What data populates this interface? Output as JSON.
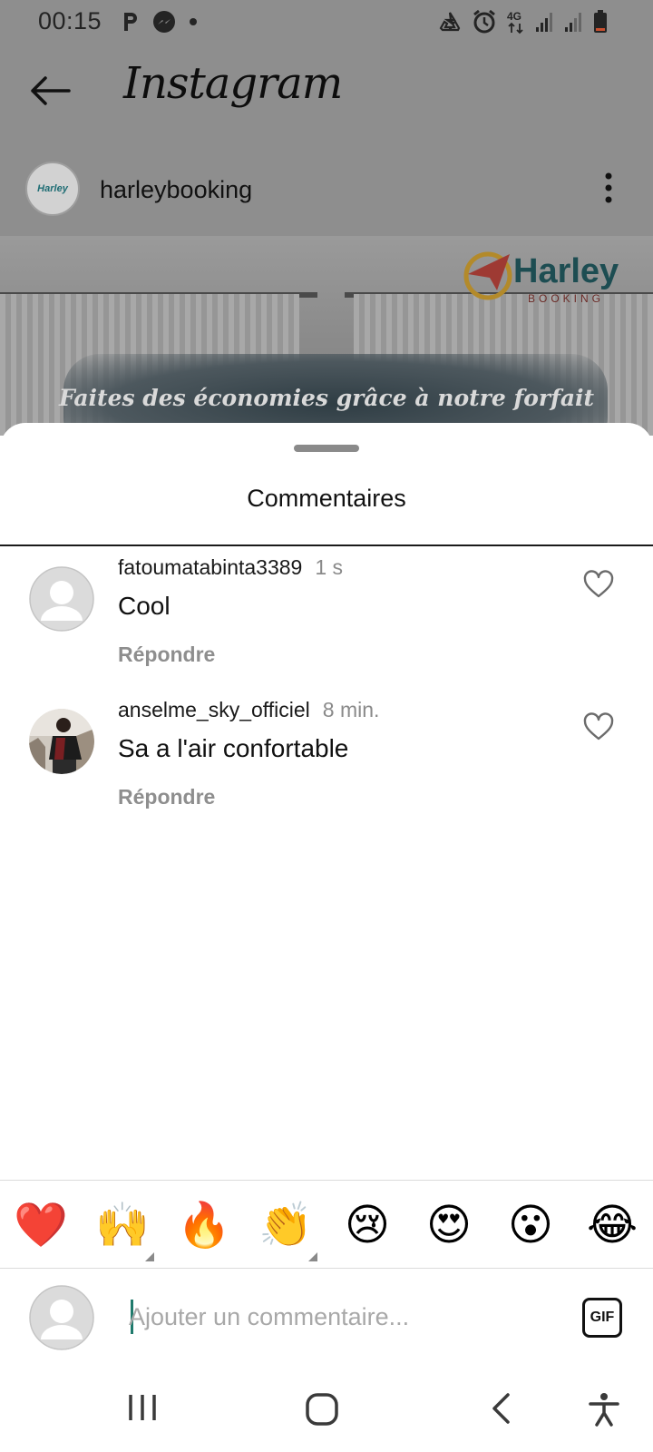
{
  "status_bar": {
    "time": "00:15",
    "icons_left": [
      "parking-icon",
      "messenger-icon",
      "notification-dot-icon"
    ],
    "icons_right": [
      "recycle-icon",
      "alarm-icon",
      "network-4g-icon",
      "signal-icon",
      "signal-icon",
      "battery-low-icon"
    ],
    "network_label": "4G"
  },
  "header": {
    "app_title": "Instagram",
    "back_icon": "back-arrow-icon"
  },
  "post": {
    "username": "harleybooking",
    "avatar_logo_text": "Harley",
    "caption_overlay": "Faites des économies grâce à notre forfait",
    "brand_name": "Harley",
    "brand_sub": "BOOKING",
    "more_icon": "more-vertical-icon"
  },
  "comments_sheet": {
    "title": "Commentaires",
    "comments": [
      {
        "username": "fatoumatabinta3389",
        "time": "1 s",
        "text": "Cool",
        "reply_label": "Répondre",
        "liked": false
      },
      {
        "username": "anselme_sky_officiel",
        "time": "8 min.",
        "text": "Sa a l'air confortable",
        "reply_label": "Répondre",
        "liked": false
      }
    ]
  },
  "quick_reactions": [
    {
      "name": "red-heart",
      "glyph": "❤️"
    },
    {
      "name": "raising-hands",
      "glyph": "🙌"
    },
    {
      "name": "fire",
      "glyph": "🔥"
    },
    {
      "name": "clapping-hands",
      "glyph": "👏"
    },
    {
      "name": "crying-face",
      "glyph": "😢"
    },
    {
      "name": "heart-eyes",
      "glyph": "😍"
    },
    {
      "name": "surprised-face",
      "glyph": "😮"
    },
    {
      "name": "tears-of-joy",
      "glyph": "😂"
    }
  ],
  "comment_input": {
    "placeholder": "Ajouter un commentaire...",
    "value": "",
    "gif_label": "GIF"
  },
  "nav_bar": {
    "buttons": [
      "recent-apps-icon",
      "home-icon",
      "back-icon",
      "accessibility-icon"
    ]
  },
  "colors": {
    "dim_overlay": "#8e8e8e",
    "divider": "#dbdbdb",
    "secondary_text": "#8e8e8e",
    "caret": "#1f7a6c"
  }
}
